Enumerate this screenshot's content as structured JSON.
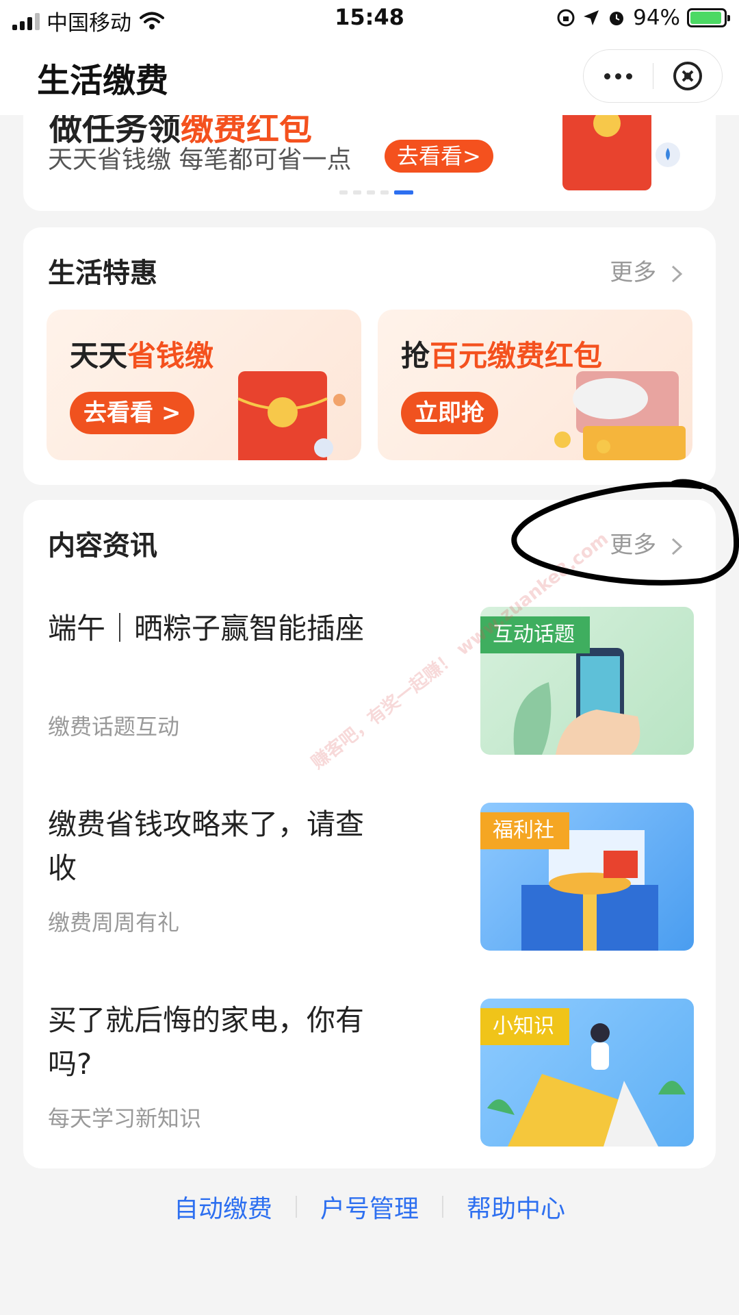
{
  "status_bar": {
    "carrier": "中国移动",
    "time": "15:48",
    "battery_pct": "94%",
    "battery_level": 0.94
  },
  "nav": {
    "title": "生活缴费"
  },
  "banner": {
    "title_part1": "做任务领",
    "title_highlight": "缴费红包",
    "subtitle": "天天省钱缴 每笔都可省一点",
    "button": "去看看>",
    "page_count": 5,
    "active_page": 5
  },
  "perks": {
    "title": "生活特惠",
    "more": "更多",
    "items": [
      {
        "title_plain": "天天",
        "title_highlight": "省钱缴",
        "button": "去看看 >"
      },
      {
        "title_plain": "抢",
        "title_highlight": "百元缴费红包",
        "button": "立即抢"
      }
    ]
  },
  "news": {
    "title": "内容资讯",
    "more": "更多",
    "items": [
      {
        "title": "端午｜晒粽子赢智能插座",
        "source": "缴费话题互动",
        "tag": "互动话题",
        "tag_color": "#3fae5f"
      },
      {
        "title": "缴费省钱攻略来了，请查收",
        "source": "缴费周周有礼",
        "tag": "福利社",
        "tag_color": "#f5a623"
      },
      {
        "title": "买了就后悔的家电，你有吗?",
        "source": "每天学习新知识",
        "tag": "小知识",
        "tag_color": "#f0c419"
      }
    ]
  },
  "footer": {
    "links": [
      "自动缴费",
      "户号管理",
      "帮助中心"
    ]
  },
  "watermark": "赚客吧，有奖一起赚！ www.zuanke8.com",
  "colors": {
    "accent": "#f4511e",
    "link": "#2d6ff0"
  }
}
